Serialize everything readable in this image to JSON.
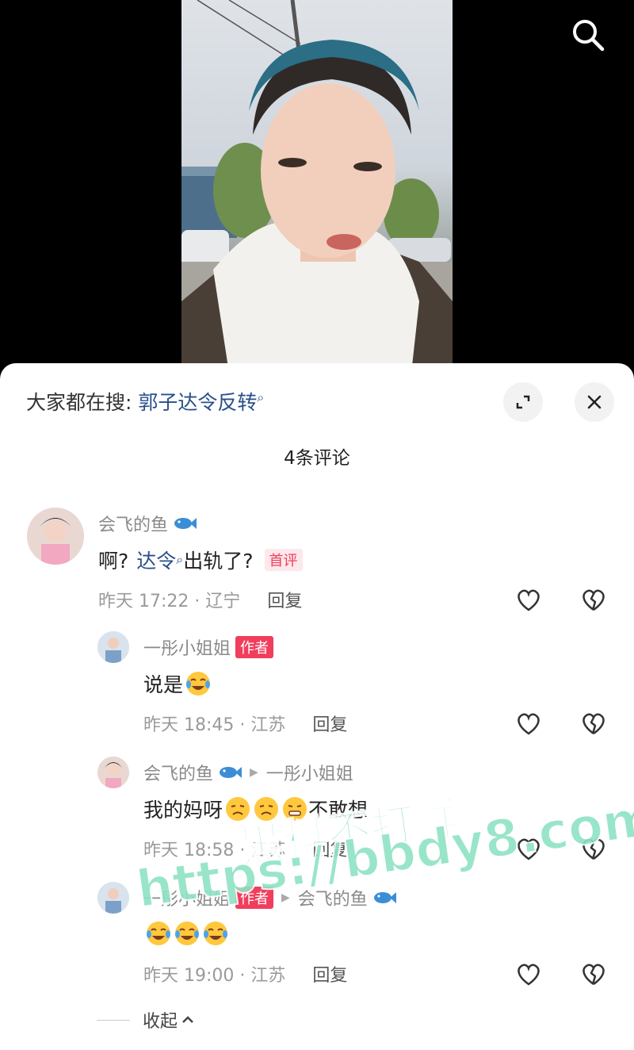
{
  "sheet": {
    "hot_search_prefix": "大家都在搜:",
    "hot_search_keyword": "郭子达令反转",
    "comment_count_title": "4条评论",
    "collapse_label": "收起"
  },
  "comments": [
    {
      "username": "会飞的鱼",
      "text_prefix": "啊?",
      "text_keyword": "达令",
      "text_suffix": "出轨了?",
      "badge": "首评",
      "time_location": "昨天 17:22 · 辽宁",
      "reply_label": "回复"
    },
    {
      "username": "一彤小姐姐",
      "badge": "作者",
      "text": "说是",
      "time_location": "昨天 18:45 · 江苏",
      "reply_label": "回复"
    },
    {
      "username": "会飞的鱼",
      "reply_to": "一彤小姐姐",
      "text_prefix": "我的妈呀",
      "text_suffix": "不敢想",
      "time_location": "昨天 18:58 · 江苏",
      "reply_label": "回复"
    },
    {
      "username": "一彤小姐姐",
      "badge": "作者",
      "reply_to": "会飞的鱼",
      "time_location": "昨天 19:00 · 江苏",
      "reply_label": "回复"
    }
  ],
  "watermark": {
    "line1": "黑料不打烊",
    "line2": "https://bbdy8.com"
  },
  "colors": {
    "keyword_blue": "#2a4f8a",
    "author_badge_red": "#f03e5c",
    "watermark_green": "#8fe3c4"
  }
}
